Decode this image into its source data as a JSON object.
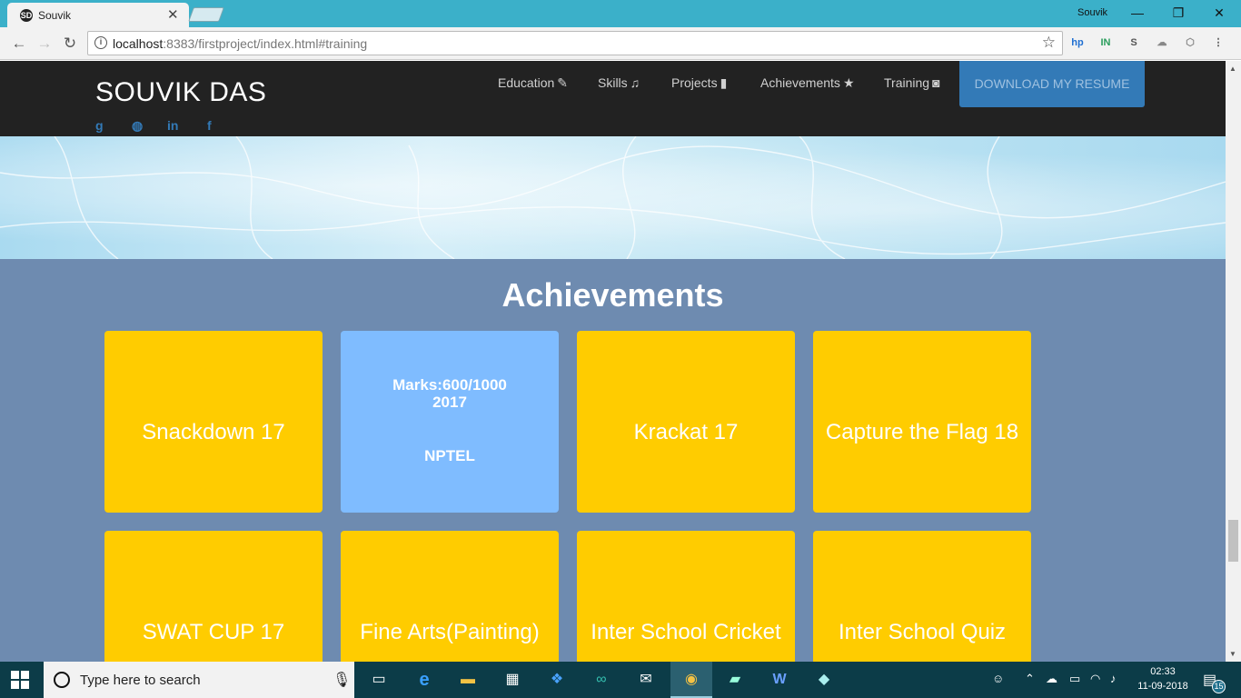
{
  "browser": {
    "tab_title": "Souvik",
    "tab_favicon": "SD",
    "tab_close": "✕",
    "profile_name": "Souvik",
    "url_host": "localhost",
    "url_rest": ":8383/firstproject/index.html#training",
    "win_minimize": "—",
    "win_restore": "❐",
    "win_close": "✕",
    "back": "←",
    "forward": "→",
    "reload": "↻",
    "bookmark_star": "☆",
    "extensions": [
      {
        "name": "hp-extension-icon",
        "glyph": "hp",
        "color": "#1f6fd1"
      },
      {
        "name": "in-extension-icon",
        "glyph": "IN",
        "color": "#2a9d5c"
      },
      {
        "name": "s-extension-icon",
        "glyph": "S",
        "color": "#555555"
      },
      {
        "name": "cloud-extension-icon",
        "glyph": "☁",
        "color": "#888888"
      },
      {
        "name": "cube-extension-icon",
        "glyph": "⬡",
        "color": "#888888"
      },
      {
        "name": "menu-icon",
        "glyph": "⋮",
        "color": "#555555"
      }
    ]
  },
  "site": {
    "brand": "SOUVIK DAS",
    "social": [
      "g",
      "◍",
      "in",
      "f"
    ],
    "nav": [
      {
        "label": "Education",
        "icon": "✎"
      },
      {
        "label": "Skills",
        "icon": "♫"
      },
      {
        "label": "Projects",
        "icon": "▮"
      },
      {
        "label": "Achievements",
        "icon": "★"
      },
      {
        "label": "Training",
        "icon": "◙"
      }
    ],
    "resume_button": "DOWNLOAD MY RESUME"
  },
  "achievements": {
    "title": "Achievements",
    "cards": [
      {
        "title": "Snackdown 17"
      },
      {
        "back_line1": "Marks:600/1000",
        "back_line2": "2017",
        "back_sub": "NPTEL"
      },
      {
        "title": "Krackat 17"
      },
      {
        "title": "Capture the Flag 18"
      },
      {
        "title": "SWAT CUP 17"
      },
      {
        "title": "Fine Arts(Painting)"
      },
      {
        "title": "Inter School Cricket"
      },
      {
        "title": "Inter School Quiz"
      }
    ]
  },
  "taskbar": {
    "search_placeholder": "Type here to search",
    "time": "02:33",
    "date": "11-09-2018",
    "notification_count": "15"
  },
  "colors": {
    "navbar": "#222222",
    "section_bg": "#6e8bb0",
    "card_yellow": "#ffcc00",
    "card_blue": "#7fbcff",
    "resume_btn": "#337ab7"
  }
}
